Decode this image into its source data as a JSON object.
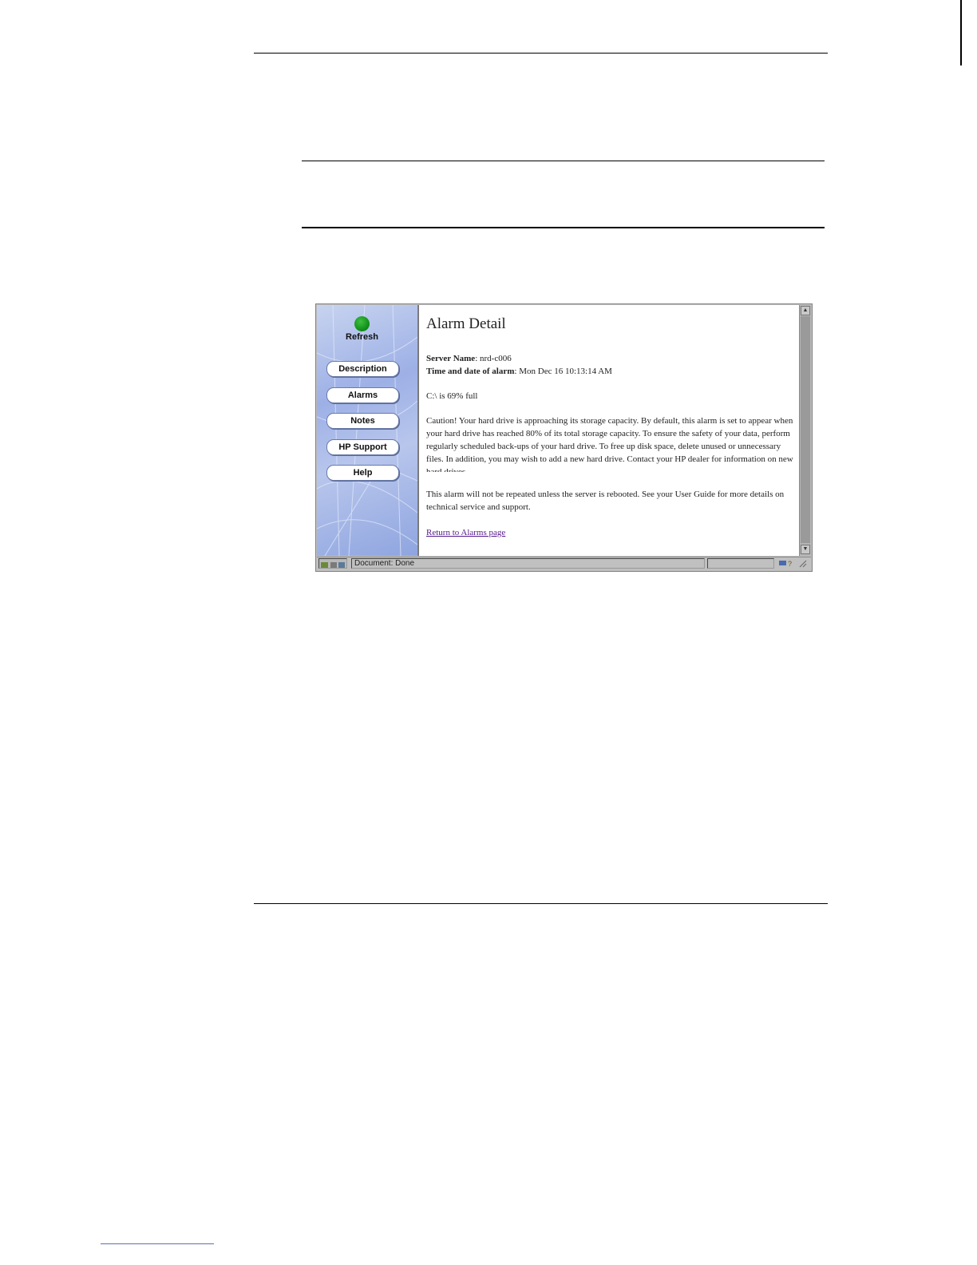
{
  "sidebar": {
    "refresh_label": "Refresh",
    "buttons": [
      "Description",
      "Alarms",
      "Notes",
      "HP Support",
      "Help"
    ]
  },
  "content": {
    "title": "Alarm Detail",
    "server_name_label": "Server Name",
    "server_name_value": "nrd-c006",
    "time_label": "Time and date of alarm",
    "time_value": "Mon Dec 16 10:13:14 AM",
    "usage": "C:\\ is 69% full",
    "caution": "Caution! Your hard drive is approaching its storage capacity. By default, this alarm is set to appear when your hard drive has reached 80% of its total storage capacity. To ensure the safety of your data, perform regularly scheduled back-ups of your hard drive. To free up disk space, delete unused or unnecessary files. In addition, you may wish to add a new hard drive. Contact your HP dealer for information on new hard drives.",
    "repeat_note": "This alarm will not be repeated unless the server is rebooted. See your User Guide for more details on technical service and support.",
    "return_link": "Return to Alarms page"
  },
  "status": {
    "text": "Document: Done"
  },
  "colors": {
    "refresh_dot": "#1a9e24",
    "link": "#551a8b",
    "sidebar_bg": "#a9bbe8"
  }
}
